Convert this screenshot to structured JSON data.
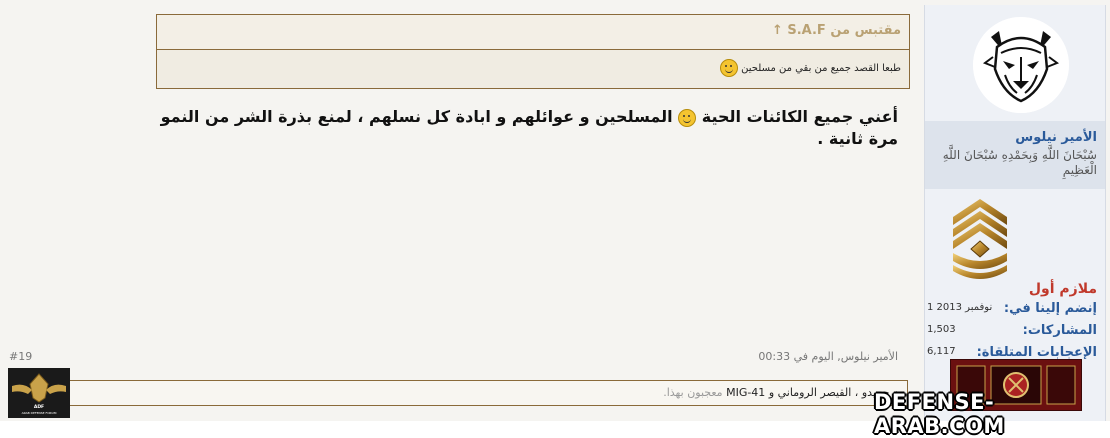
{
  "quote": {
    "header": "مقتبس من S.A.F ↑",
    "text": "طبعا القصد جميع من بقي من مسلحين"
  },
  "message": {
    "part1": "أعني جميع الكائنات الحية",
    "part2": "المسلحين و عوائلهم و ابادة كل نسلهم ، لمنع بذرة الشر من النمو مرة ثانية ."
  },
  "user": {
    "name": "الأمير نيلوس",
    "title": "سُبْحَانَ اللَّهِ وَبِحَمْدِهِ سُبْحَانَ اللَّهِ الْعَظِيمِ",
    "rank": "ملازم أول",
    "stats": [
      {
        "label": "إنضم إلينا في:",
        "value": "1 نوفمبر 2013"
      },
      {
        "label": "المشاركات:",
        "value": "1,503"
      },
      {
        "label": "الإعجابات المتلقاة:",
        "value": "6,117"
      }
    ]
  },
  "footer": {
    "post_number": "#19",
    "meta": "الأمير نيلوس, اليوم في 00:33",
    "likes": {
      "names": [
        "ن حميدو",
        "القيصر الروماني",
        "MIG-41"
      ],
      "sep1": "،",
      "sep2": "و",
      "suffix": "معجبون بهذا."
    }
  },
  "watermark": "DEFENSE-ARAB.COM",
  "logo_text": "ARAB DEFENSE FORUM",
  "colors": {
    "username": "#2a5a9a",
    "rank": "#c0392b",
    "quote_border": "#8a6a3a",
    "quote_header": "#b9a173"
  },
  "icons": [
    "wolf-avatar",
    "rank-chevrons-icon",
    "smile-icon",
    "trophy-icon",
    "forum-logo"
  ]
}
